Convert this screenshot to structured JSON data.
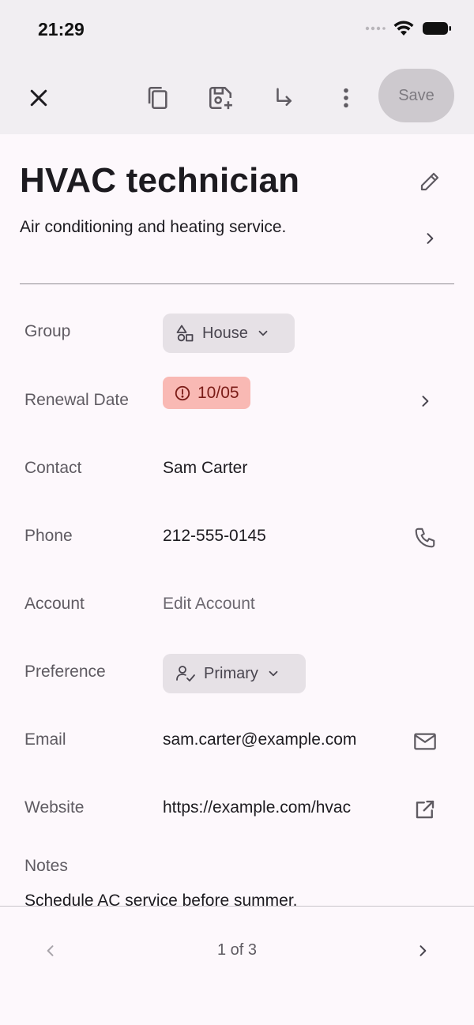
{
  "status": {
    "time": "21:29"
  },
  "toolbar": {
    "close_icon": "close-icon",
    "copy_icon": "copy-icon",
    "save_as_icon": "save-add-icon",
    "move_icon": "subdirectory-arrow-icon",
    "more_icon": "more-vert-icon",
    "save_label": "Save"
  },
  "header": {
    "title": "HVAC technician",
    "subtitle": "Air conditioning and heating service."
  },
  "fields": {
    "group": {
      "label": "Group",
      "value": "House"
    },
    "renewal": {
      "label": "Renewal Date",
      "value": "10/05"
    },
    "contact": {
      "label": "Contact",
      "value": "Sam Carter"
    },
    "phone": {
      "label": "Phone",
      "value": "212-555-0145"
    },
    "account": {
      "label": "Account",
      "value": "Edit Account"
    },
    "preference": {
      "label": "Preference",
      "value": "Primary"
    },
    "email": {
      "label": "Email",
      "value": "sam.carter@example.com"
    },
    "website": {
      "label": "Website",
      "value": "https://example.com/hvac"
    },
    "notes": {
      "label": "Notes",
      "value": "Schedule AC service before summer."
    }
  },
  "pager": {
    "text": "1 of 3"
  },
  "colors": {
    "alert_bg": "#f9b9b4",
    "alert_fg": "#7a1c17",
    "chip_bg": "#e6e1e6"
  }
}
